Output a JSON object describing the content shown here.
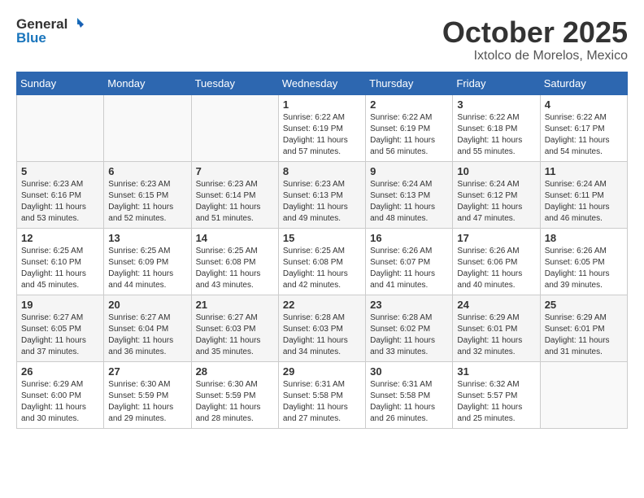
{
  "header": {
    "logo_general": "General",
    "logo_blue": "Blue",
    "month_title": "October 2025",
    "subtitle": "Ixtolco de Morelos, Mexico"
  },
  "calendar": {
    "days_of_week": [
      "Sunday",
      "Monday",
      "Tuesday",
      "Wednesday",
      "Thursday",
      "Friday",
      "Saturday"
    ],
    "weeks": [
      [
        {
          "day": "",
          "sunrise": "",
          "sunset": "",
          "daylight": ""
        },
        {
          "day": "",
          "sunrise": "",
          "sunset": "",
          "daylight": ""
        },
        {
          "day": "",
          "sunrise": "",
          "sunset": "",
          "daylight": ""
        },
        {
          "day": "1",
          "sunrise": "Sunrise: 6:22 AM",
          "sunset": "Sunset: 6:19 PM",
          "daylight": "Daylight: 11 hours and 57 minutes."
        },
        {
          "day": "2",
          "sunrise": "Sunrise: 6:22 AM",
          "sunset": "Sunset: 6:19 PM",
          "daylight": "Daylight: 11 hours and 56 minutes."
        },
        {
          "day": "3",
          "sunrise": "Sunrise: 6:22 AM",
          "sunset": "Sunset: 6:18 PM",
          "daylight": "Daylight: 11 hours and 55 minutes."
        },
        {
          "day": "4",
          "sunrise": "Sunrise: 6:22 AM",
          "sunset": "Sunset: 6:17 PM",
          "daylight": "Daylight: 11 hours and 54 minutes."
        }
      ],
      [
        {
          "day": "5",
          "sunrise": "Sunrise: 6:23 AM",
          "sunset": "Sunset: 6:16 PM",
          "daylight": "Daylight: 11 hours and 53 minutes."
        },
        {
          "day": "6",
          "sunrise": "Sunrise: 6:23 AM",
          "sunset": "Sunset: 6:15 PM",
          "daylight": "Daylight: 11 hours and 52 minutes."
        },
        {
          "day": "7",
          "sunrise": "Sunrise: 6:23 AM",
          "sunset": "Sunset: 6:14 PM",
          "daylight": "Daylight: 11 hours and 51 minutes."
        },
        {
          "day": "8",
          "sunrise": "Sunrise: 6:23 AM",
          "sunset": "Sunset: 6:13 PM",
          "daylight": "Daylight: 11 hours and 49 minutes."
        },
        {
          "day": "9",
          "sunrise": "Sunrise: 6:24 AM",
          "sunset": "Sunset: 6:13 PM",
          "daylight": "Daylight: 11 hours and 48 minutes."
        },
        {
          "day": "10",
          "sunrise": "Sunrise: 6:24 AM",
          "sunset": "Sunset: 6:12 PM",
          "daylight": "Daylight: 11 hours and 47 minutes."
        },
        {
          "day": "11",
          "sunrise": "Sunrise: 6:24 AM",
          "sunset": "Sunset: 6:11 PM",
          "daylight": "Daylight: 11 hours and 46 minutes."
        }
      ],
      [
        {
          "day": "12",
          "sunrise": "Sunrise: 6:25 AM",
          "sunset": "Sunset: 6:10 PM",
          "daylight": "Daylight: 11 hours and 45 minutes."
        },
        {
          "day": "13",
          "sunrise": "Sunrise: 6:25 AM",
          "sunset": "Sunset: 6:09 PM",
          "daylight": "Daylight: 11 hours and 44 minutes."
        },
        {
          "day": "14",
          "sunrise": "Sunrise: 6:25 AM",
          "sunset": "Sunset: 6:08 PM",
          "daylight": "Daylight: 11 hours and 43 minutes."
        },
        {
          "day": "15",
          "sunrise": "Sunrise: 6:25 AM",
          "sunset": "Sunset: 6:08 PM",
          "daylight": "Daylight: 11 hours and 42 minutes."
        },
        {
          "day": "16",
          "sunrise": "Sunrise: 6:26 AM",
          "sunset": "Sunset: 6:07 PM",
          "daylight": "Daylight: 11 hours and 41 minutes."
        },
        {
          "day": "17",
          "sunrise": "Sunrise: 6:26 AM",
          "sunset": "Sunset: 6:06 PM",
          "daylight": "Daylight: 11 hours and 40 minutes."
        },
        {
          "day": "18",
          "sunrise": "Sunrise: 6:26 AM",
          "sunset": "Sunset: 6:05 PM",
          "daylight": "Daylight: 11 hours and 39 minutes."
        }
      ],
      [
        {
          "day": "19",
          "sunrise": "Sunrise: 6:27 AM",
          "sunset": "Sunset: 6:05 PM",
          "daylight": "Daylight: 11 hours and 37 minutes."
        },
        {
          "day": "20",
          "sunrise": "Sunrise: 6:27 AM",
          "sunset": "Sunset: 6:04 PM",
          "daylight": "Daylight: 11 hours and 36 minutes."
        },
        {
          "day": "21",
          "sunrise": "Sunrise: 6:27 AM",
          "sunset": "Sunset: 6:03 PM",
          "daylight": "Daylight: 11 hours and 35 minutes."
        },
        {
          "day": "22",
          "sunrise": "Sunrise: 6:28 AM",
          "sunset": "Sunset: 6:03 PM",
          "daylight": "Daylight: 11 hours and 34 minutes."
        },
        {
          "day": "23",
          "sunrise": "Sunrise: 6:28 AM",
          "sunset": "Sunset: 6:02 PM",
          "daylight": "Daylight: 11 hours and 33 minutes."
        },
        {
          "day": "24",
          "sunrise": "Sunrise: 6:29 AM",
          "sunset": "Sunset: 6:01 PM",
          "daylight": "Daylight: 11 hours and 32 minutes."
        },
        {
          "day": "25",
          "sunrise": "Sunrise: 6:29 AM",
          "sunset": "Sunset: 6:01 PM",
          "daylight": "Daylight: 11 hours and 31 minutes."
        }
      ],
      [
        {
          "day": "26",
          "sunrise": "Sunrise: 6:29 AM",
          "sunset": "Sunset: 6:00 PM",
          "daylight": "Daylight: 11 hours and 30 minutes."
        },
        {
          "day": "27",
          "sunrise": "Sunrise: 6:30 AM",
          "sunset": "Sunset: 5:59 PM",
          "daylight": "Daylight: 11 hours and 29 minutes."
        },
        {
          "day": "28",
          "sunrise": "Sunrise: 6:30 AM",
          "sunset": "Sunset: 5:59 PM",
          "daylight": "Daylight: 11 hours and 28 minutes."
        },
        {
          "day": "29",
          "sunrise": "Sunrise: 6:31 AM",
          "sunset": "Sunset: 5:58 PM",
          "daylight": "Daylight: 11 hours and 27 minutes."
        },
        {
          "day": "30",
          "sunrise": "Sunrise: 6:31 AM",
          "sunset": "Sunset: 5:58 PM",
          "daylight": "Daylight: 11 hours and 26 minutes."
        },
        {
          "day": "31",
          "sunrise": "Sunrise: 6:32 AM",
          "sunset": "Sunset: 5:57 PM",
          "daylight": "Daylight: 11 hours and 25 minutes."
        },
        {
          "day": "",
          "sunrise": "",
          "sunset": "",
          "daylight": ""
        }
      ]
    ]
  }
}
